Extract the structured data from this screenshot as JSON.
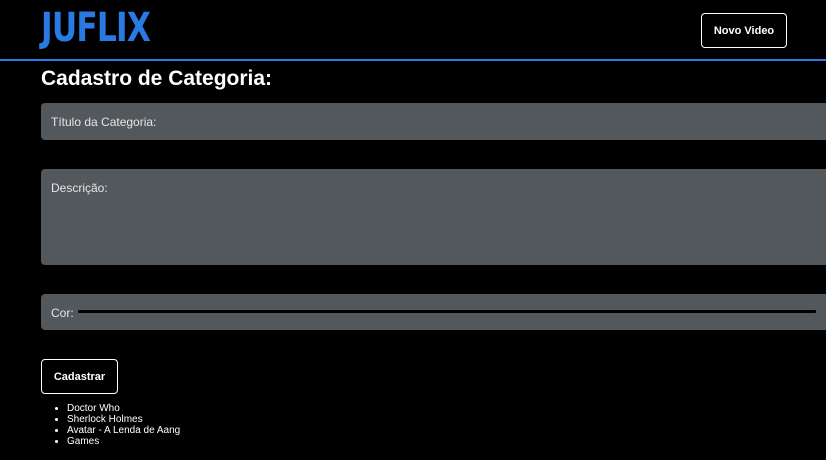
{
  "header": {
    "logo": "JUFLIX",
    "new_video_label": "Novo Video"
  },
  "form": {
    "title": "Cadastro de Categoria:",
    "title_field_label": "Título da Categoria:",
    "description_field_label": "Descrição:",
    "color_field_label": "Cor:",
    "color_value": "#000000",
    "submit_label": "Cadastrar"
  },
  "categories": [
    "Doctor Who",
    "Sherlock Holmes",
    "Avatar - A Lenda de Aang",
    "Games"
  ],
  "colors": {
    "brand": "#2a7ae4",
    "background": "#000000",
    "field_background": "#53585d"
  }
}
